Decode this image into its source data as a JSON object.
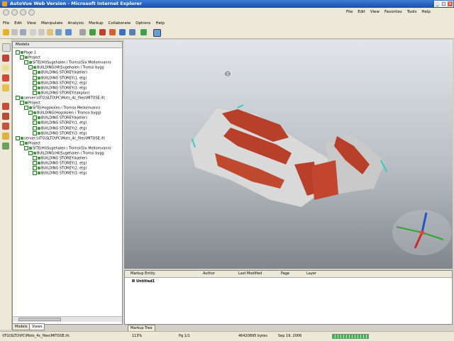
{
  "window": {
    "title": "AutoVue Web Version - Microsoft Internet Explorer"
  },
  "ie_menu": [
    "File",
    "Edit",
    "View",
    "Favorites",
    "Tools",
    "Help"
  ],
  "app_menu": [
    "File",
    "Edit",
    "View",
    "Manipulate",
    "Analysis",
    "Markup",
    "Collaborate",
    "Options",
    "Help"
  ],
  "model_panel": {
    "header": "Models",
    "tree": [
      {
        "label": "Page 1",
        "level": 0
      },
      {
        "label": "Project",
        "level": 1
      },
      {
        "label": "SITE(HI)Sugehalen i Tromsi(Six Mellomvann)",
        "level": 2
      },
      {
        "label": "BUILDING(HI)Sugehalen i Tromsi bygg",
        "level": 3
      },
      {
        "label": "BUILDING STOREY(kjeller)",
        "level": 4
      },
      {
        "label": "BUILDING STOREY(1. etg)",
        "level": 4
      },
      {
        "label": "BUILDING STOREY(2. etg)",
        "level": 4
      },
      {
        "label": "BUILDING STOREY(3. etg)",
        "level": 4
      },
      {
        "label": "BUILDING STOREY(takplan)",
        "level": 4
      },
      {
        "label": "server:\\\\ITG\\SLTD\\PC\\Mots_4c_files\\MITOSE.ifc",
        "level": 0
      },
      {
        "label": "Project",
        "level": 1
      },
      {
        "label": "SITE(Hogskolen i Tromso Mellomvann)",
        "level": 2
      },
      {
        "label": "BUILDING(Hogskolen i Tromso bygg)",
        "level": 3
      },
      {
        "label": "BUILDING STOREY(kjeller)",
        "level": 4
      },
      {
        "label": "BUILDING STOREY(1. etg)",
        "level": 4
      },
      {
        "label": "BUILDING STOREY(2. etg)",
        "level": 4
      },
      {
        "label": "BUILDING STOREY(3. etg)",
        "level": 4
      },
      {
        "label": "server:\\\\ITG\\SLTD\\PC\\Mots_4c_files\\MITOSE.ifc",
        "level": 0
      },
      {
        "label": "Project",
        "level": 1
      },
      {
        "label": "SITE(HI)Sugehalen i Tromsi(Six Mellomvann)",
        "level": 2
      },
      {
        "label": "BUILDING(HI)Sugehalen i Tromsi bygg",
        "level": 3
      },
      {
        "label": "BUILDING STOREY(kjeller)",
        "level": 4
      },
      {
        "label": "BUILDING STOREY(1. etg)",
        "level": 4
      },
      {
        "label": "BUILDING STOREY(2. etg)",
        "level": 4
      },
      {
        "label": "BUILDING STOREY(3. etg)",
        "level": 4
      }
    ]
  },
  "panel_tabs": [
    "Models",
    "Views"
  ],
  "markup_panel": {
    "columns": [
      "Markup Entity",
      "Author",
      "Last Modified",
      "Page",
      "Layer"
    ],
    "rows": [
      {
        "entity": "Untitled1"
      }
    ]
  },
  "markup_tab": "Markup Tree",
  "status": {
    "path": "\\ITG\\SLTD\\PC\\Mots_4c_files\\MITOSE.ifc",
    "zoom": "113%",
    "page": "Pg 1/1",
    "size": "46420895 bytes",
    "date": "Sep 19, 2006"
  },
  "colors": {
    "roof_red": "#b8402a",
    "wall_grey": "#d9d9d9",
    "accent_cyan": "#37c9c9"
  },
  "icons": [
    "back-icon",
    "forward-icon",
    "zoom-icon",
    "rotate-icon",
    "pan-icon",
    "select-icon",
    "markup-pen-icon",
    "measure-icon",
    "axis-triad-icon"
  ]
}
